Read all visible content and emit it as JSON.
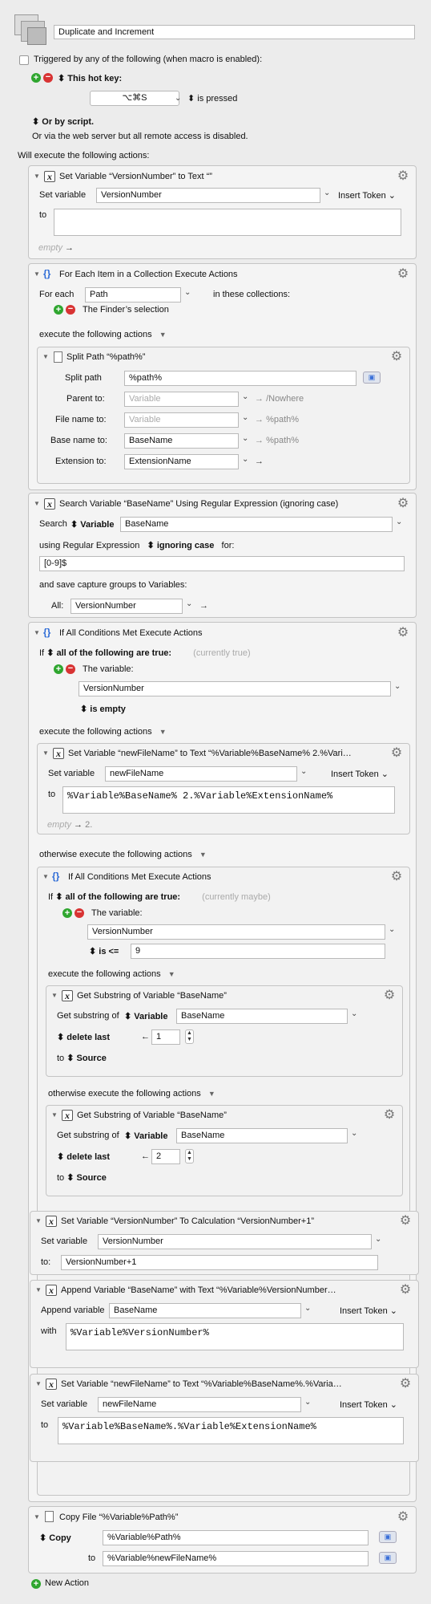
{
  "macro": {
    "name": "Duplicate and Increment",
    "trigger_label": "Triggered by any of the following (when macro is enabled):",
    "hotkey_label": "This hot key:",
    "hotkey_value": "⌥⌘S",
    "hotkey_state": "is pressed",
    "or_script": "Or by script.",
    "webserver": "Or via the web server but all remote access is disabled.",
    "will_execute": "Will execute the following actions:",
    "new_action": "New Action"
  },
  "a1": {
    "title": "Set Variable “VersionNumber” to Text “”",
    "set_var_label": "Set variable",
    "var": "VersionNumber",
    "insert_token": "Insert Token",
    "to_label": "to",
    "empty": "empty"
  },
  "a2": {
    "title": "For Each Item in a Collection Execute Actions",
    "for_each_label": "For each",
    "var": "Path",
    "in_collections": "in these collections:",
    "collection": "The Finder’s selection",
    "execute_label": "execute the following actions"
  },
  "a2s": {
    "title": "Split Path “%path%”",
    "split_path_label": "Split path",
    "split_path": "%path%",
    "parent_label": "Parent to:",
    "parent_ph": "Variable",
    "parent_result": "/Nowhere",
    "filename_label": "File name to:",
    "filename_ph": "Variable",
    "filename_result": "%path%",
    "basename_label": "Base name to:",
    "basename": "BaseName",
    "basename_result": "%path%",
    "ext_label": "Extension to:",
    "ext": "ExtensionName"
  },
  "a3": {
    "title": "Search Variable “BaseName” Using Regular Expression (ignoring case)",
    "search_label": "Search",
    "variable_label": "Variable",
    "var": "BaseName",
    "using_label": "using Regular Expression",
    "ignoring_case": "ignoring case",
    "for_label": "for:",
    "regex": "[0-9]$",
    "save_label": "and save capture groups to Variables:",
    "all_label": "All:",
    "all_var": "VersionNumber"
  },
  "a4": {
    "title": "If All Conditions Met Execute Actions",
    "if_label": "If",
    "all_following": "all of the following are true:",
    "currently": "(currently true)",
    "the_variable": "The variable:",
    "var": "VersionNumber",
    "is_empty": "is empty",
    "execute_label": "execute the following actions",
    "otherwise_label": "otherwise execute the following actions"
  },
  "a4a": {
    "title": "Set Variable “newFileName” to Text “%Variable%BaseName% 2.%Vari…",
    "set_var_label": "Set variable",
    "var": "newFileName",
    "insert_token": "Insert Token",
    "to_label": "to",
    "value": "%Variable%BaseName% 2.%Variable%ExtensionName%",
    "empty": "empty",
    "result": "2."
  },
  "a5": {
    "title": "If All Conditions Met Execute Actions",
    "if_label": "If",
    "all_following": "all of the following are true:",
    "currently": "(currently maybe)",
    "the_variable": "The variable:",
    "var": "VersionNumber",
    "is_le": "is <=",
    "value": "9",
    "execute_label": "execute the following actions",
    "otherwise_label": "otherwise execute the following actions"
  },
  "a5a": {
    "title": "Get Substring of Variable “BaseName”",
    "get_label": "Get substring of",
    "variable_label": "Variable",
    "var": "BaseName",
    "delete_label": "delete last",
    "count": "1",
    "to_label": "to",
    "source": "Source"
  },
  "a5b": {
    "title": "Get Substring of Variable “BaseName”",
    "get_label": "Get substring of",
    "variable_label": "Variable",
    "var": "BaseName",
    "delete_label": "delete last",
    "count": "2",
    "to_label": "to",
    "source": "Source"
  },
  "a6": {
    "title": "Set Variable “VersionNumber” To Calculation “VersionNumber+1”",
    "set_var_label": "Set variable",
    "var": "VersionNumber",
    "to_label": "to:",
    "value": "VersionNumber+1"
  },
  "a7": {
    "title": "Append Variable “BaseName” with Text “%Variable%VersionNumber…",
    "append_label": "Append variable",
    "var": "BaseName",
    "insert_token": "Insert Token",
    "with_label": "with",
    "value": "%Variable%VersionNumber%"
  },
  "a8": {
    "title": "Set Variable “newFileName” to Text “%Variable%BaseName%.%Varia…",
    "set_var_label": "Set variable",
    "var": "newFileName",
    "insert_token": "Insert Token",
    "to_label": "to",
    "value": "%Variable%BaseName%.%Variable%ExtensionName%"
  },
  "a9": {
    "title": "Copy File “%Variable%Path%”",
    "copy_label": "Copy",
    "src": "%Variable%Path%",
    "to_label": "to",
    "dest": "%Variable%newFileName%"
  }
}
